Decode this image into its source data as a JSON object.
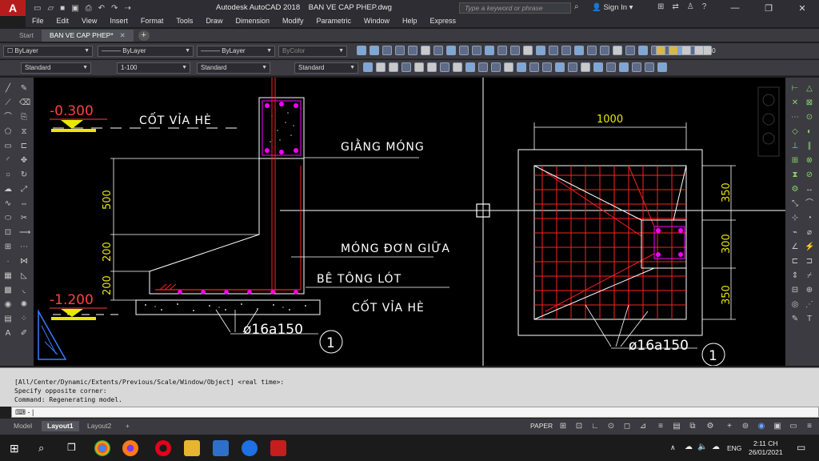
{
  "window": {
    "app_title": "Autodesk AutoCAD 2018",
    "file_name": "BAN VE CAP PHEP.dwg",
    "search_placeholder": "Type a keyword or phrase",
    "sign_in": "Sign In"
  },
  "menu": [
    "File",
    "Edit",
    "View",
    "Insert",
    "Format",
    "Tools",
    "Draw",
    "Dimension",
    "Modify",
    "Parametric",
    "Window",
    "Help",
    "Express"
  ],
  "tabs": [
    {
      "label": "Start",
      "active": false
    },
    {
      "label": "BAN VE CAP PHEP*",
      "active": true
    }
  ],
  "properties": {
    "layer": "0",
    "color": "ByLayer",
    "linetype": "ByLayer",
    "lineweight": "ByLayer",
    "plotstyle": "ByColor",
    "text_style": "Standard",
    "scale": "1-100",
    "dim_style": "Standard",
    "table_style": "Standard"
  },
  "drawing": {
    "section": {
      "level_top": "-0.300",
      "level_bottom": "-1.200",
      "dim_500": "500",
      "dim_200a": "200",
      "dim_200b": "200",
      "label_cot_via_he_top": "CỐT VỈA HÈ",
      "label_giang_mong": "GIẰNG MÓNG",
      "label_mong_don": "MÓNG ĐƠN GIỮA",
      "label_be_tong_lot": "BÊ TÔNG LÓT",
      "label_cot_via_he_bot": "CỐT VỈA HÈ",
      "rebar": "ø16a150",
      "bubble": "1"
    },
    "plan": {
      "dim_1000": "1000",
      "dim_350a": "350",
      "dim_300": "300",
      "dim_350b": "350",
      "rebar": "ø16a150",
      "bubble": "1"
    }
  },
  "command": {
    "lines": [
      "[All/Center/Dynamic/Extents/Previous/Scale/Window/Object] <real time>:",
      "Specify opposite corner:",
      "Command: Regenerating model."
    ],
    "prompt": "-"
  },
  "layout_tabs": [
    {
      "label": "Model",
      "active": false
    },
    {
      "label": "Layout1",
      "active": true
    },
    {
      "label": "Layout2",
      "active": false
    }
  ],
  "status": {
    "space": "PAPER"
  },
  "taskbar": {
    "lang": "ENG",
    "time": "2:11 CH",
    "date": "26/01/2021"
  },
  "colors": {
    "rebar_red": "#ff2020",
    "magenta": "#ff00ff",
    "yellow": "#e8e800",
    "line_white": "#ffffff"
  }
}
